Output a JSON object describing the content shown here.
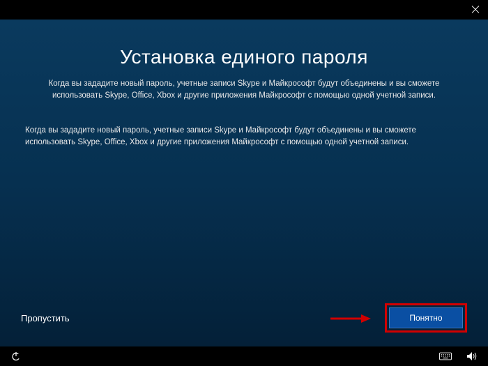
{
  "titlebar": {
    "close_icon": "close"
  },
  "content": {
    "title": "Установка единого пароля",
    "subtitle": "Когда вы зададите новый пароль, учетные записи Skype и Майкрософт будут объединены и вы сможете использовать Skype, Office, Xbox и другие приложения Майкрософт с помощью одной учетной записи.",
    "body_text": "Когда вы зададите новый пароль, учетные записи Skype и Майкрософт будут объединены и вы сможете использовать Skype, Office, Xbox и другие приложения Майкрософт с помощью одной учетной записи."
  },
  "actions": {
    "skip_label": "Пропустить",
    "primary_label": "Понятно"
  },
  "taskbar": {
    "left_icons": [
      "power-icon"
    ],
    "right_icons": [
      "keyboard-icon",
      "volume-icon"
    ]
  },
  "annotation": {
    "arrow_color": "#d10000",
    "highlight_color": "#d10000"
  }
}
